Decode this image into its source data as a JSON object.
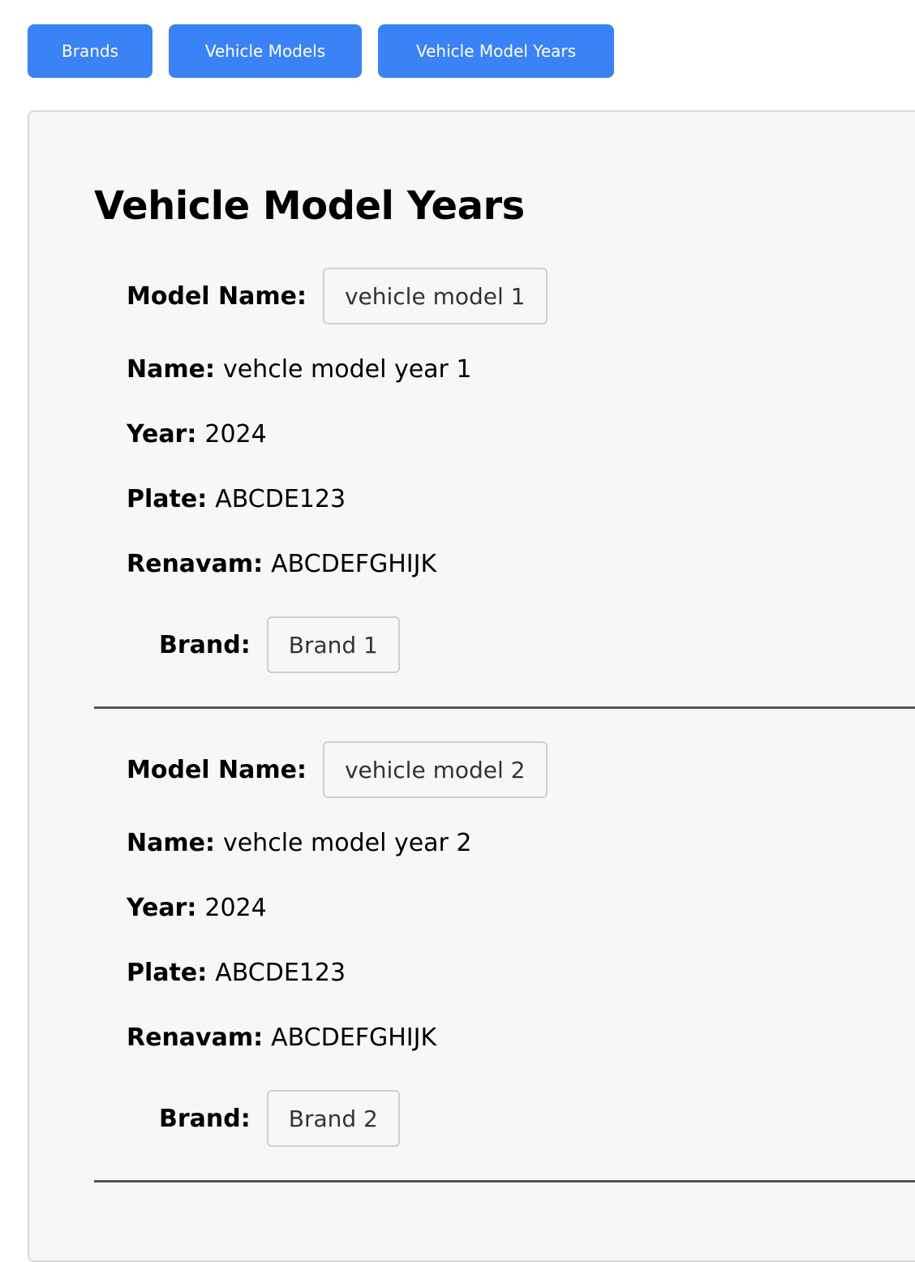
{
  "nav": {
    "buttons": [
      "Brands",
      "Vehicle Models",
      "Vehicle Model Years"
    ],
    "color": "#3b82f6"
  },
  "page": {
    "title": "Vehicle Model Years"
  },
  "labels": {
    "model_name": "Model Name:",
    "name": "Name:",
    "year": "Year:",
    "plate": "Plate:",
    "renavam": "Renavam:",
    "brand": "Brand:"
  },
  "records": [
    {
      "model_name": "vehicle model 1",
      "name": "vehcle model year 1",
      "year": "2024",
      "plate": "ABCDE123",
      "renavam": "ABCDEFGHIJK",
      "brand": "Brand 1"
    },
    {
      "model_name": "vehicle model 2",
      "name": "vehcle model year 2",
      "year": "2024",
      "plate": "ABCDE123",
      "renavam": "ABCDEFGHIJK",
      "brand": "Brand 2"
    }
  ]
}
